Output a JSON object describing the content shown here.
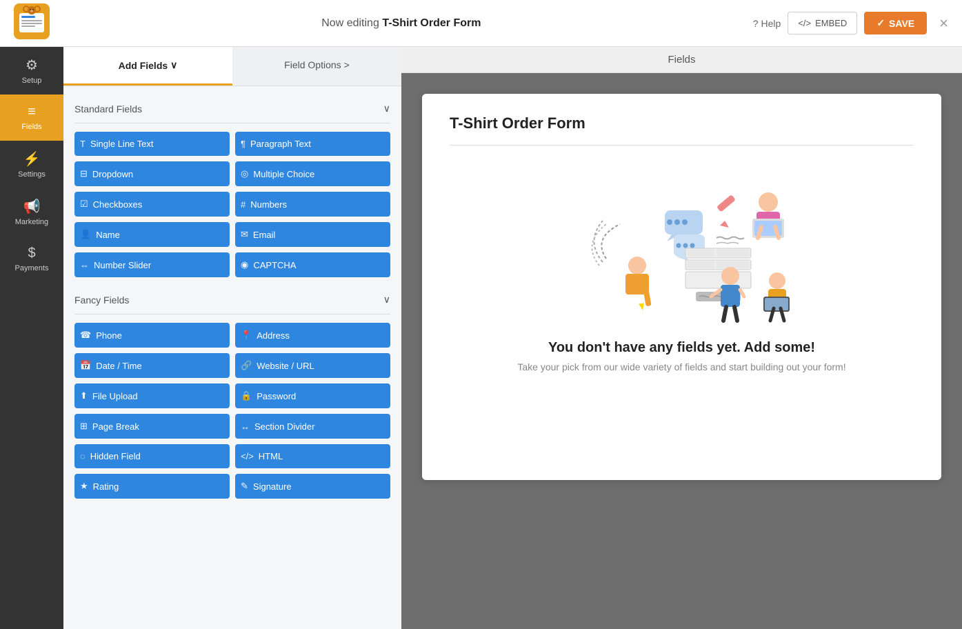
{
  "app": {
    "logo_alt": "WPForms logo",
    "editing_label": "Now editing",
    "form_name": "T-Shirt Order Form",
    "help_label": "Help",
    "embed_label": "</> EMBED",
    "save_label": "✓ SAVE",
    "close_label": "×"
  },
  "sidebar": {
    "items": [
      {
        "id": "setup",
        "label": "Setup",
        "icon": "⚙"
      },
      {
        "id": "fields",
        "label": "Fields",
        "icon": "≡",
        "active": true
      },
      {
        "id": "settings",
        "label": "Settings",
        "icon": "⚡"
      },
      {
        "id": "marketing",
        "label": "Marketing",
        "icon": "📢"
      },
      {
        "id": "payments",
        "label": "Payments",
        "icon": "$"
      }
    ]
  },
  "fields_panel": {
    "tab_add": "Add Fields",
    "tab_options": "Field Options",
    "tab_add_arrow": "∨",
    "tab_options_arrow": ">",
    "sections": [
      {
        "id": "standard",
        "label": "Standard Fields",
        "fields": [
          {
            "id": "single-line-text",
            "label": "Single Line Text",
            "icon": "T"
          },
          {
            "id": "paragraph-text",
            "label": "Paragraph Text",
            "icon": "¶"
          },
          {
            "id": "dropdown",
            "label": "Dropdown",
            "icon": "⊟"
          },
          {
            "id": "multiple-choice",
            "label": "Multiple Choice",
            "icon": "◎"
          },
          {
            "id": "checkboxes",
            "label": "Checkboxes",
            "icon": "☑"
          },
          {
            "id": "numbers",
            "label": "Numbers",
            "icon": "#"
          },
          {
            "id": "name",
            "label": "Name",
            "icon": "👤"
          },
          {
            "id": "email",
            "label": "Email",
            "icon": "✉"
          },
          {
            "id": "number-slider",
            "label": "Number Slider",
            "icon": "⇔"
          },
          {
            "id": "captcha",
            "label": "CAPTCHA",
            "icon": "◉"
          }
        ]
      },
      {
        "id": "fancy",
        "label": "Fancy Fields",
        "fields": [
          {
            "id": "phone",
            "label": "Phone",
            "icon": "☎"
          },
          {
            "id": "address",
            "label": "Address",
            "icon": "📍"
          },
          {
            "id": "date-time",
            "label": "Date / Time",
            "icon": "📅"
          },
          {
            "id": "website-url",
            "label": "Website / URL",
            "icon": "🔗"
          },
          {
            "id": "file-upload",
            "label": "File Upload",
            "icon": "⬆"
          },
          {
            "id": "password",
            "label": "Password",
            "icon": "🔒"
          },
          {
            "id": "page-break",
            "label": "Page Break",
            "icon": "⊞"
          },
          {
            "id": "section-divider",
            "label": "Section Divider",
            "icon": "↔"
          },
          {
            "id": "hidden-field",
            "label": "Hidden Field",
            "icon": "◌"
          },
          {
            "id": "html",
            "label": "HTML",
            "icon": "</>"
          },
          {
            "id": "rating",
            "label": "Rating",
            "icon": "★"
          },
          {
            "id": "signature",
            "label": "Signature",
            "icon": "✎"
          }
        ]
      }
    ]
  },
  "content": {
    "header": "Fields",
    "form_title": "T-Shirt Order Form",
    "empty_title": "You don't have any fields yet. Add some!",
    "empty_subtitle": "Take your pick from our wide variety of fields and start building out your form!"
  }
}
